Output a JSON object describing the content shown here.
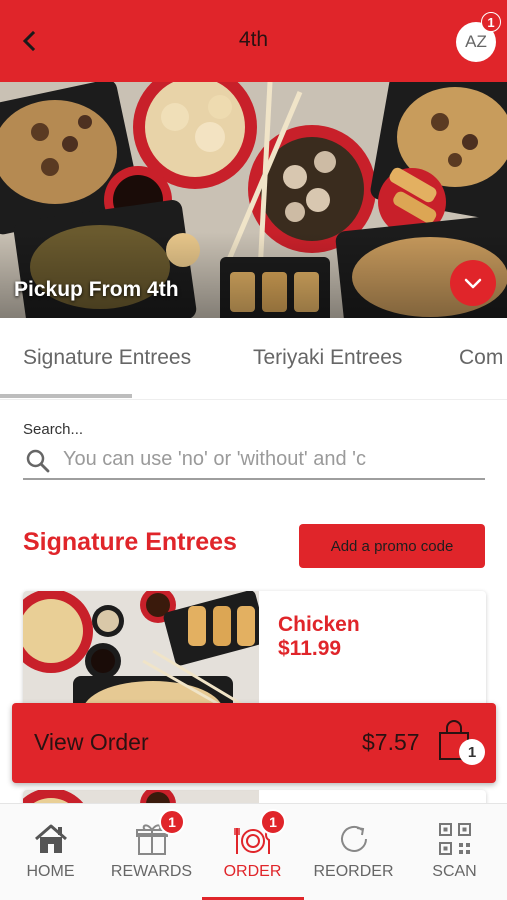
{
  "header": {
    "title": "4th",
    "avatar_initials": "AZ",
    "notification_count": "1",
    "back_icon": "chevron-left-icon"
  },
  "hero": {
    "label": "Pickup From 4th",
    "toggle_icon": "chevron-down-icon"
  },
  "tabs": [
    "Signature Entrees",
    "Teriyaki Entrees",
    "Com"
  ],
  "search": {
    "label": "Search...",
    "placeholder": "You can use 'no' or 'without' and 'c"
  },
  "section": {
    "title": "Signature Entrees",
    "promo_label": "Add a promo code"
  },
  "menu_items": [
    {
      "name": "Chicken",
      "price": "$11.99"
    },
    {
      "name": "",
      "price": ""
    }
  ],
  "view_order": {
    "label": "View Order",
    "total": "$7.57",
    "item_count": "1",
    "bag_icon": "shopping-bag-icon"
  },
  "bottom_nav": [
    {
      "label": "HOME",
      "icon": "home-icon",
      "badge": ""
    },
    {
      "label": "REWARDS",
      "icon": "gift-icon",
      "badge": "1"
    },
    {
      "label": "ORDER",
      "icon": "plate-cutlery-icon",
      "badge": "1",
      "active": true
    },
    {
      "label": "REORDER",
      "icon": "refresh-icon",
      "badge": ""
    },
    {
      "label": "SCAN",
      "icon": "qr-code-icon",
      "badge": ""
    }
  ],
  "colors": {
    "brand_red": "#e0252a",
    "tab_inactive": "#666666",
    "nav_inactive": "#666666"
  }
}
